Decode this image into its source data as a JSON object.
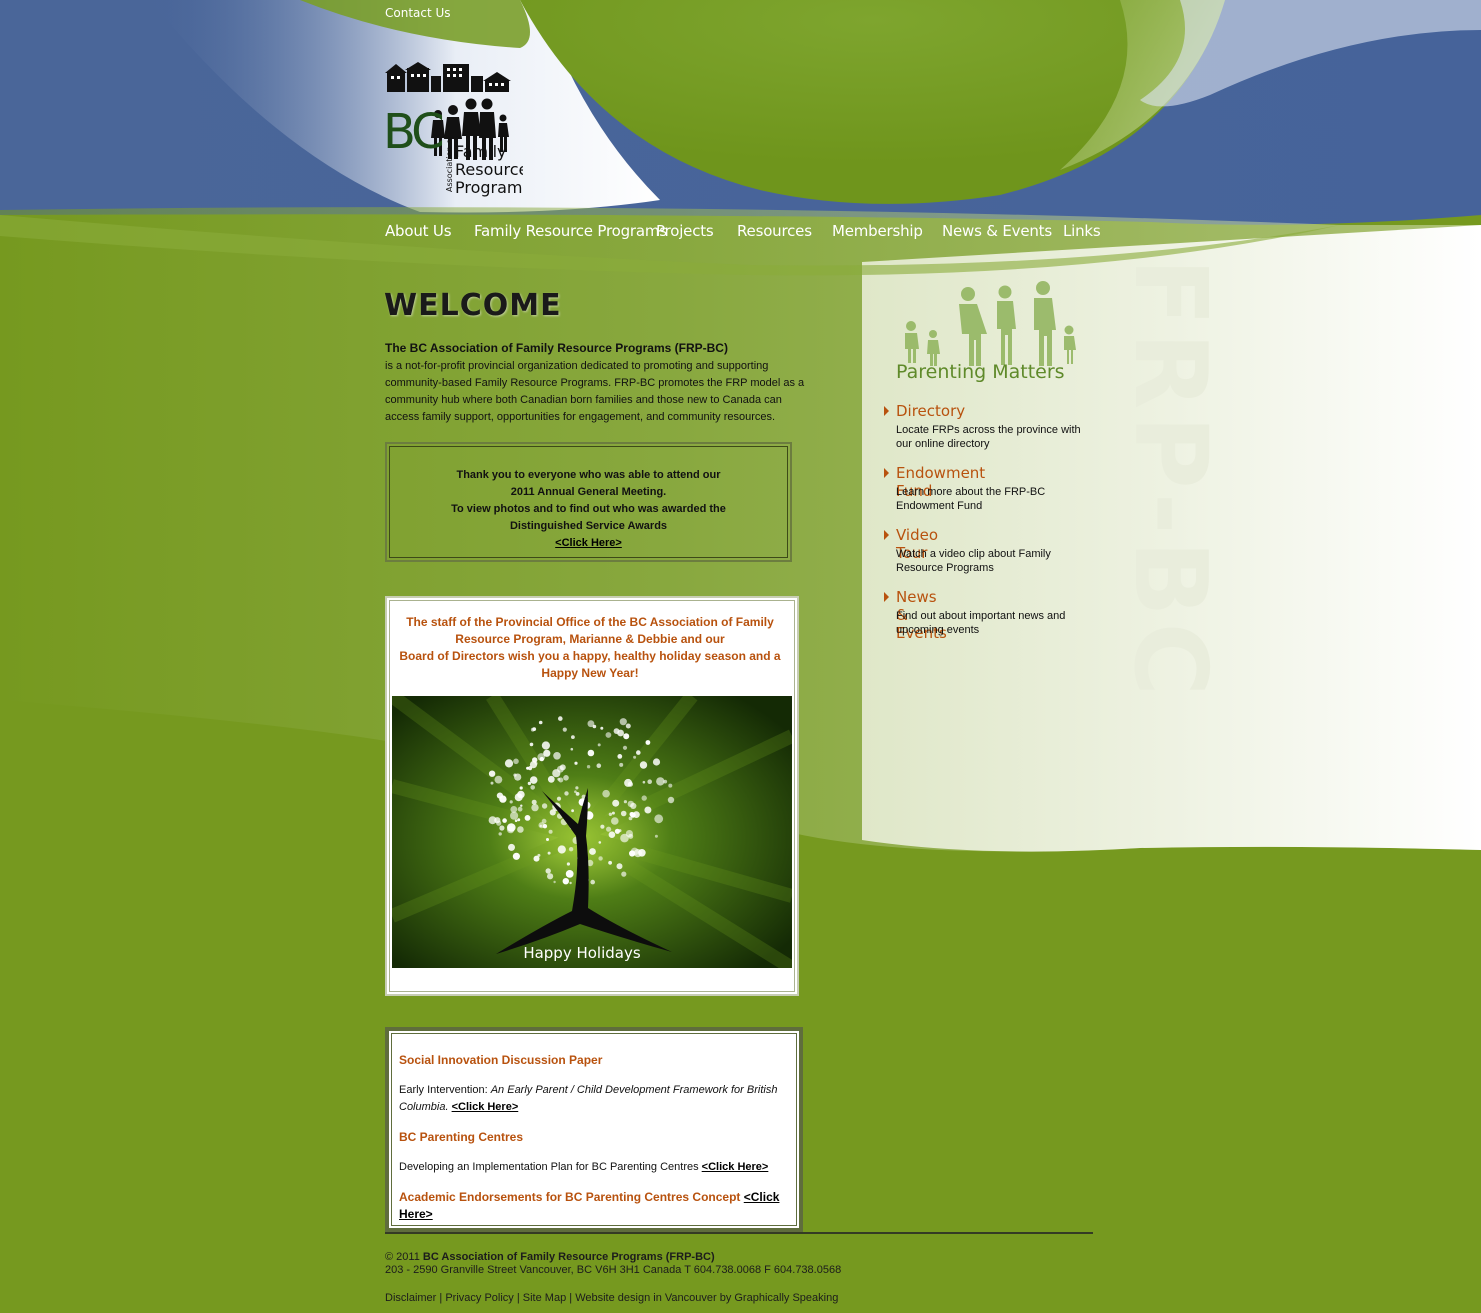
{
  "header": {
    "contact": "Contact Us",
    "logo": {
      "letters": "BC",
      "association": "Association of",
      "line1": "Family",
      "line2": "Resource",
      "line3": "Programs"
    }
  },
  "nav": [
    "About Us",
    "Family Resource Programs",
    "Projects",
    "Resources",
    "Membership",
    "News & Events",
    "Links"
  ],
  "welcome": {
    "title": "WELCOME",
    "org_name": "The BC Association of Family Resource Programs (FRP-BC)",
    "text": "is a not-for-profit provincial organization dedicated to promoting and supporting community-based Family Resource Programs.  FRP-BC promotes the FRP model as a community hub where both Canadian born families and those new to Canada can access family support, opportunities for engagement, and community resources."
  },
  "agm": {
    "line1": "Thank you to everyone who was able to attend our",
    "line2": "2011 Annual General Meeting.",
    "line3": "To view photos and to find out who was awarded the",
    "line4": "Distinguished Service Awards",
    "link": "<Click Here>"
  },
  "holiday": {
    "line1": "The staff of the Provincial Office of the BC Association of Family Resource Program, Marianne & Debbie and our",
    "line2": "Board of Directors wish you a happy, healthy holiday season and a Happy New Year!",
    "card_text": "Happy Holidays"
  },
  "news": {
    "h1": "Social Innovation Discussion Paper",
    "p1_prefix": "Early Intervention: ",
    "p1_italic": "An Early Parent / Child Development Framework for British Columbia.",
    "link": "<Click Here>",
    "h2": "BC Parenting Centres",
    "p2": "Developing an Implementation Plan for BC Parenting Centres ",
    "h3": "Academic Endorsements for BC Parenting Centres Concept "
  },
  "sidebar": {
    "banner": "Parenting Matters",
    "vertical": "FRP-BC",
    "items": [
      {
        "title": "Directory",
        "desc": "Locate FRPs across the province with our online directory"
      },
      {
        "title": "Endowment Fund",
        "desc": "Learn more about the FRP-BC Endowment Fund"
      },
      {
        "title": "Video Tour",
        "desc": "Watch a video clip about Family Resource Programs"
      },
      {
        "title": "News & Events",
        "desc": "Find out about important news and upcoming events"
      }
    ]
  },
  "footer": {
    "copyright": "© 2011 ",
    "org": "BC Association of Family Resource Programs (FRP-BC)",
    "address": "203 - 2590 Granville Street Vancouver, BC V6H 3H1 Canada T 604.738.0068 F 604.738.0568",
    "links": [
      "Disclaimer",
      "Privacy Policy",
      "Site Map",
      "Website design in Vancouver by Graphically Speaking"
    ],
    "separator": " | "
  },
  "colors": {
    "blue": "#4e6a9c",
    "green": "#76991f",
    "accent": "#b8520e"
  }
}
